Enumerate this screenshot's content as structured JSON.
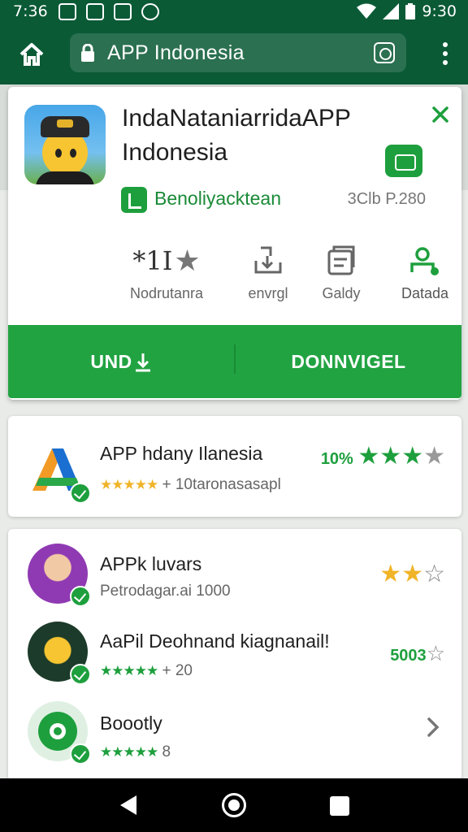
{
  "status_bar": {
    "time": "7:36",
    "clock": "9:30"
  },
  "url_bar": {
    "url": "APP Indonesia"
  },
  "app": {
    "title_line1": "IndaNataniarridaAPP",
    "title_line2": "Indonesia",
    "developer": "Benoliyacktean",
    "meta": "3Clb P.280",
    "stats": [
      {
        "value": "*1I",
        "label": "Nodrutanra"
      },
      {
        "value": "",
        "label": "envrgl"
      },
      {
        "value": "",
        "label": "Galdy"
      },
      {
        "value": "",
        "label": "Datada"
      }
    ],
    "undo_label": "UND",
    "download_label": "DONNVIGEL"
  },
  "related": {
    "title": "APP hdany Ilanesia",
    "rating_text": "10%",
    "sub_stars": "★★★★★",
    "sub_text": "+ 10taronasasapl"
  },
  "list": [
    {
      "title": "APPk luvars",
      "sub": "Petrodagar.ai 1000",
      "right": ""
    },
    {
      "title": "AaPil Deohnand kiagnanail!",
      "sub_stars": "★★★★★",
      "sub": "+ 20",
      "right": "5003"
    },
    {
      "title": "Boootly",
      "sub_stars": "★★★★★",
      "sub": "8",
      "right": ""
    }
  ],
  "colors": {
    "brand": "#0a5a36",
    "accent": "#22a342",
    "star": "#f0b428"
  }
}
